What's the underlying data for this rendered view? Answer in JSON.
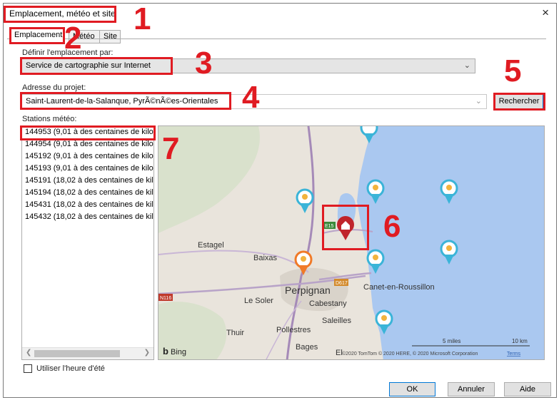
{
  "dialog": {
    "title": "Emplacement, météo et site",
    "close_icon": "×"
  },
  "tabs": [
    {
      "label": "Emplacement"
    },
    {
      "label": "Météo"
    },
    {
      "label": "Site"
    }
  ],
  "location": {
    "define_label": "Définir l'emplacement par:",
    "define_value": "Service de cartographie sur Internet",
    "address_label": "Adresse du projet:",
    "address_value": "Saint-Laurent-de-la-Salanque, PyrÃ©nÃ©es-Orientales",
    "search_button": "Rechercher",
    "stations_label": "Stations météo:"
  },
  "stations": [
    "144953 (9,01 à des centaines de kilo",
    "144954 (9,01 à des centaines de kilo",
    "145192 (9,01 à des centaines de kilo",
    "145193 (9,01 à des centaines de kilo",
    "145191 (18,02 à des centaines de kil",
    "145194 (18,02 à des centaines de kil",
    "145431 (18,02 à des centaines de kil",
    "145432 (18,02 à des centaines de kil"
  ],
  "map": {
    "places": {
      "estagel": "Estagel",
      "baixas": "Baixas",
      "perpignan": "Perpignan",
      "le_soler": "Le Soler",
      "cabestany": "Cabestany",
      "canet": "Canet-en-Roussillon",
      "saleilles": "Saleilles",
      "pollestres": "Pollestres",
      "thuir": "Thuir",
      "bages": "Bages",
      "elne": "El"
    },
    "roads": {
      "e15": "E15",
      "d617": "D617",
      "n116": "N116"
    },
    "scale_miles": "5 miles",
    "scale_km": "10 km",
    "bing": "Bing",
    "copyright": "©2020 TomTom © 2020 HERE, © 2020 Microsoft Corporation",
    "terms": "Terms"
  },
  "dst_checkbox_label": "Utiliser l'heure d'été",
  "buttons": {
    "ok": "OK",
    "cancel": "Annuler",
    "help": "Aide"
  },
  "annotations": [
    "1",
    "2",
    "3",
    "4",
    "5",
    "6",
    "7"
  ],
  "colors": {
    "annotation_red": "#e01b22",
    "water": "#aac8f0",
    "land": "#e9e4dc",
    "marker_blue": "#3bb4d8",
    "marker_orange": "#f07a28",
    "home_marker": "#c0242b"
  }
}
